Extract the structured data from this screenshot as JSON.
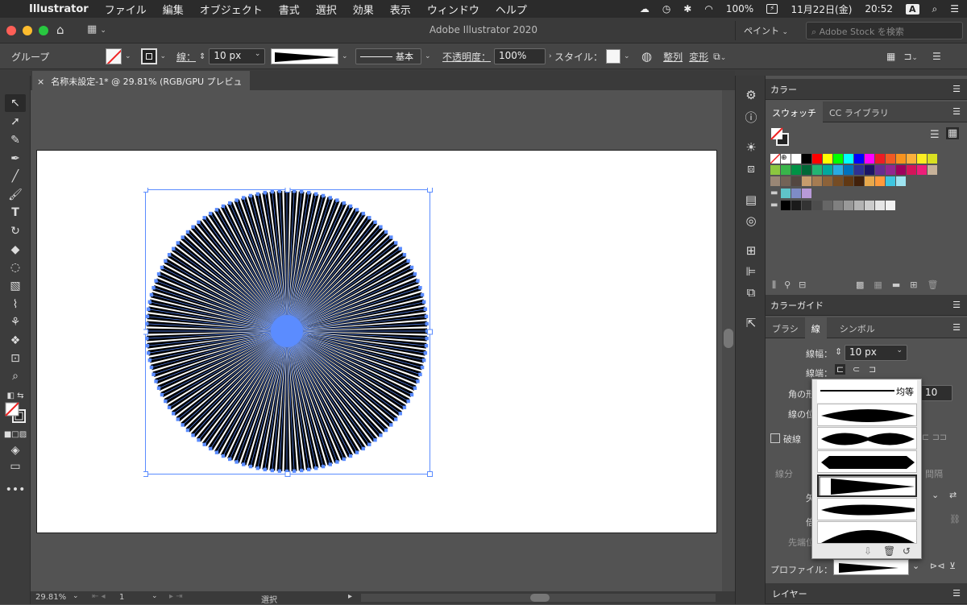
{
  "menubar": {
    "app": "Illustrator",
    "items": [
      "ファイル",
      "編集",
      "オブジェクト",
      "書式",
      "選択",
      "効果",
      "表示",
      "ウィンドウ",
      "ヘルプ"
    ],
    "battery": "100%",
    "date": "11月22日(金)",
    "time": "20:52",
    "input": "A"
  },
  "window": {
    "title": "Adobe Illustrator 2020",
    "workspace": "ペイント",
    "stock_placeholder": "Adobe Stock を検索"
  },
  "control": {
    "selection": "グループ",
    "stroke_label": "線：",
    "stroke_value": "10 px",
    "basic": "基本",
    "opacity_label": "不透明度：",
    "opacity_value": "100%",
    "style_label": "スタイル：",
    "align": "整列",
    "transform": "変形"
  },
  "doc": {
    "tab": "名称未設定-1* @ 29.81% (RGB/GPU プレビュー)"
  },
  "status": {
    "zoom": "29.81%",
    "artboard": "1",
    "mode": "選択"
  },
  "panel_color": {
    "title": "カラー",
    "tab_swatch": "スウォッチ",
    "tab_cc": "CC ライブラリ"
  },
  "panel_guide": {
    "title": "カラーガイド"
  },
  "panel_stroke": {
    "tab_brush": "ブラシ",
    "tab_stroke": "線",
    "tab_symbol": "シンボル",
    "weight_label": "線幅：",
    "weight_value": "10 px",
    "cap_label": "線端：",
    "corner_label": "角の形",
    "corner_value": "10",
    "align_label": "線の位",
    "dashed": "破線",
    "dash": "線分",
    "gap": "間隔",
    "arrow_label": "矢",
    "scale_label": "倍",
    "align_arrow": "先端位",
    "profile_label": "プロファイル：",
    "uniform": "均等"
  },
  "panel_layer": {
    "title": "レイヤー"
  },
  "colors": {
    "accent": "#4a7dff",
    "selection": "#5b8cff"
  }
}
